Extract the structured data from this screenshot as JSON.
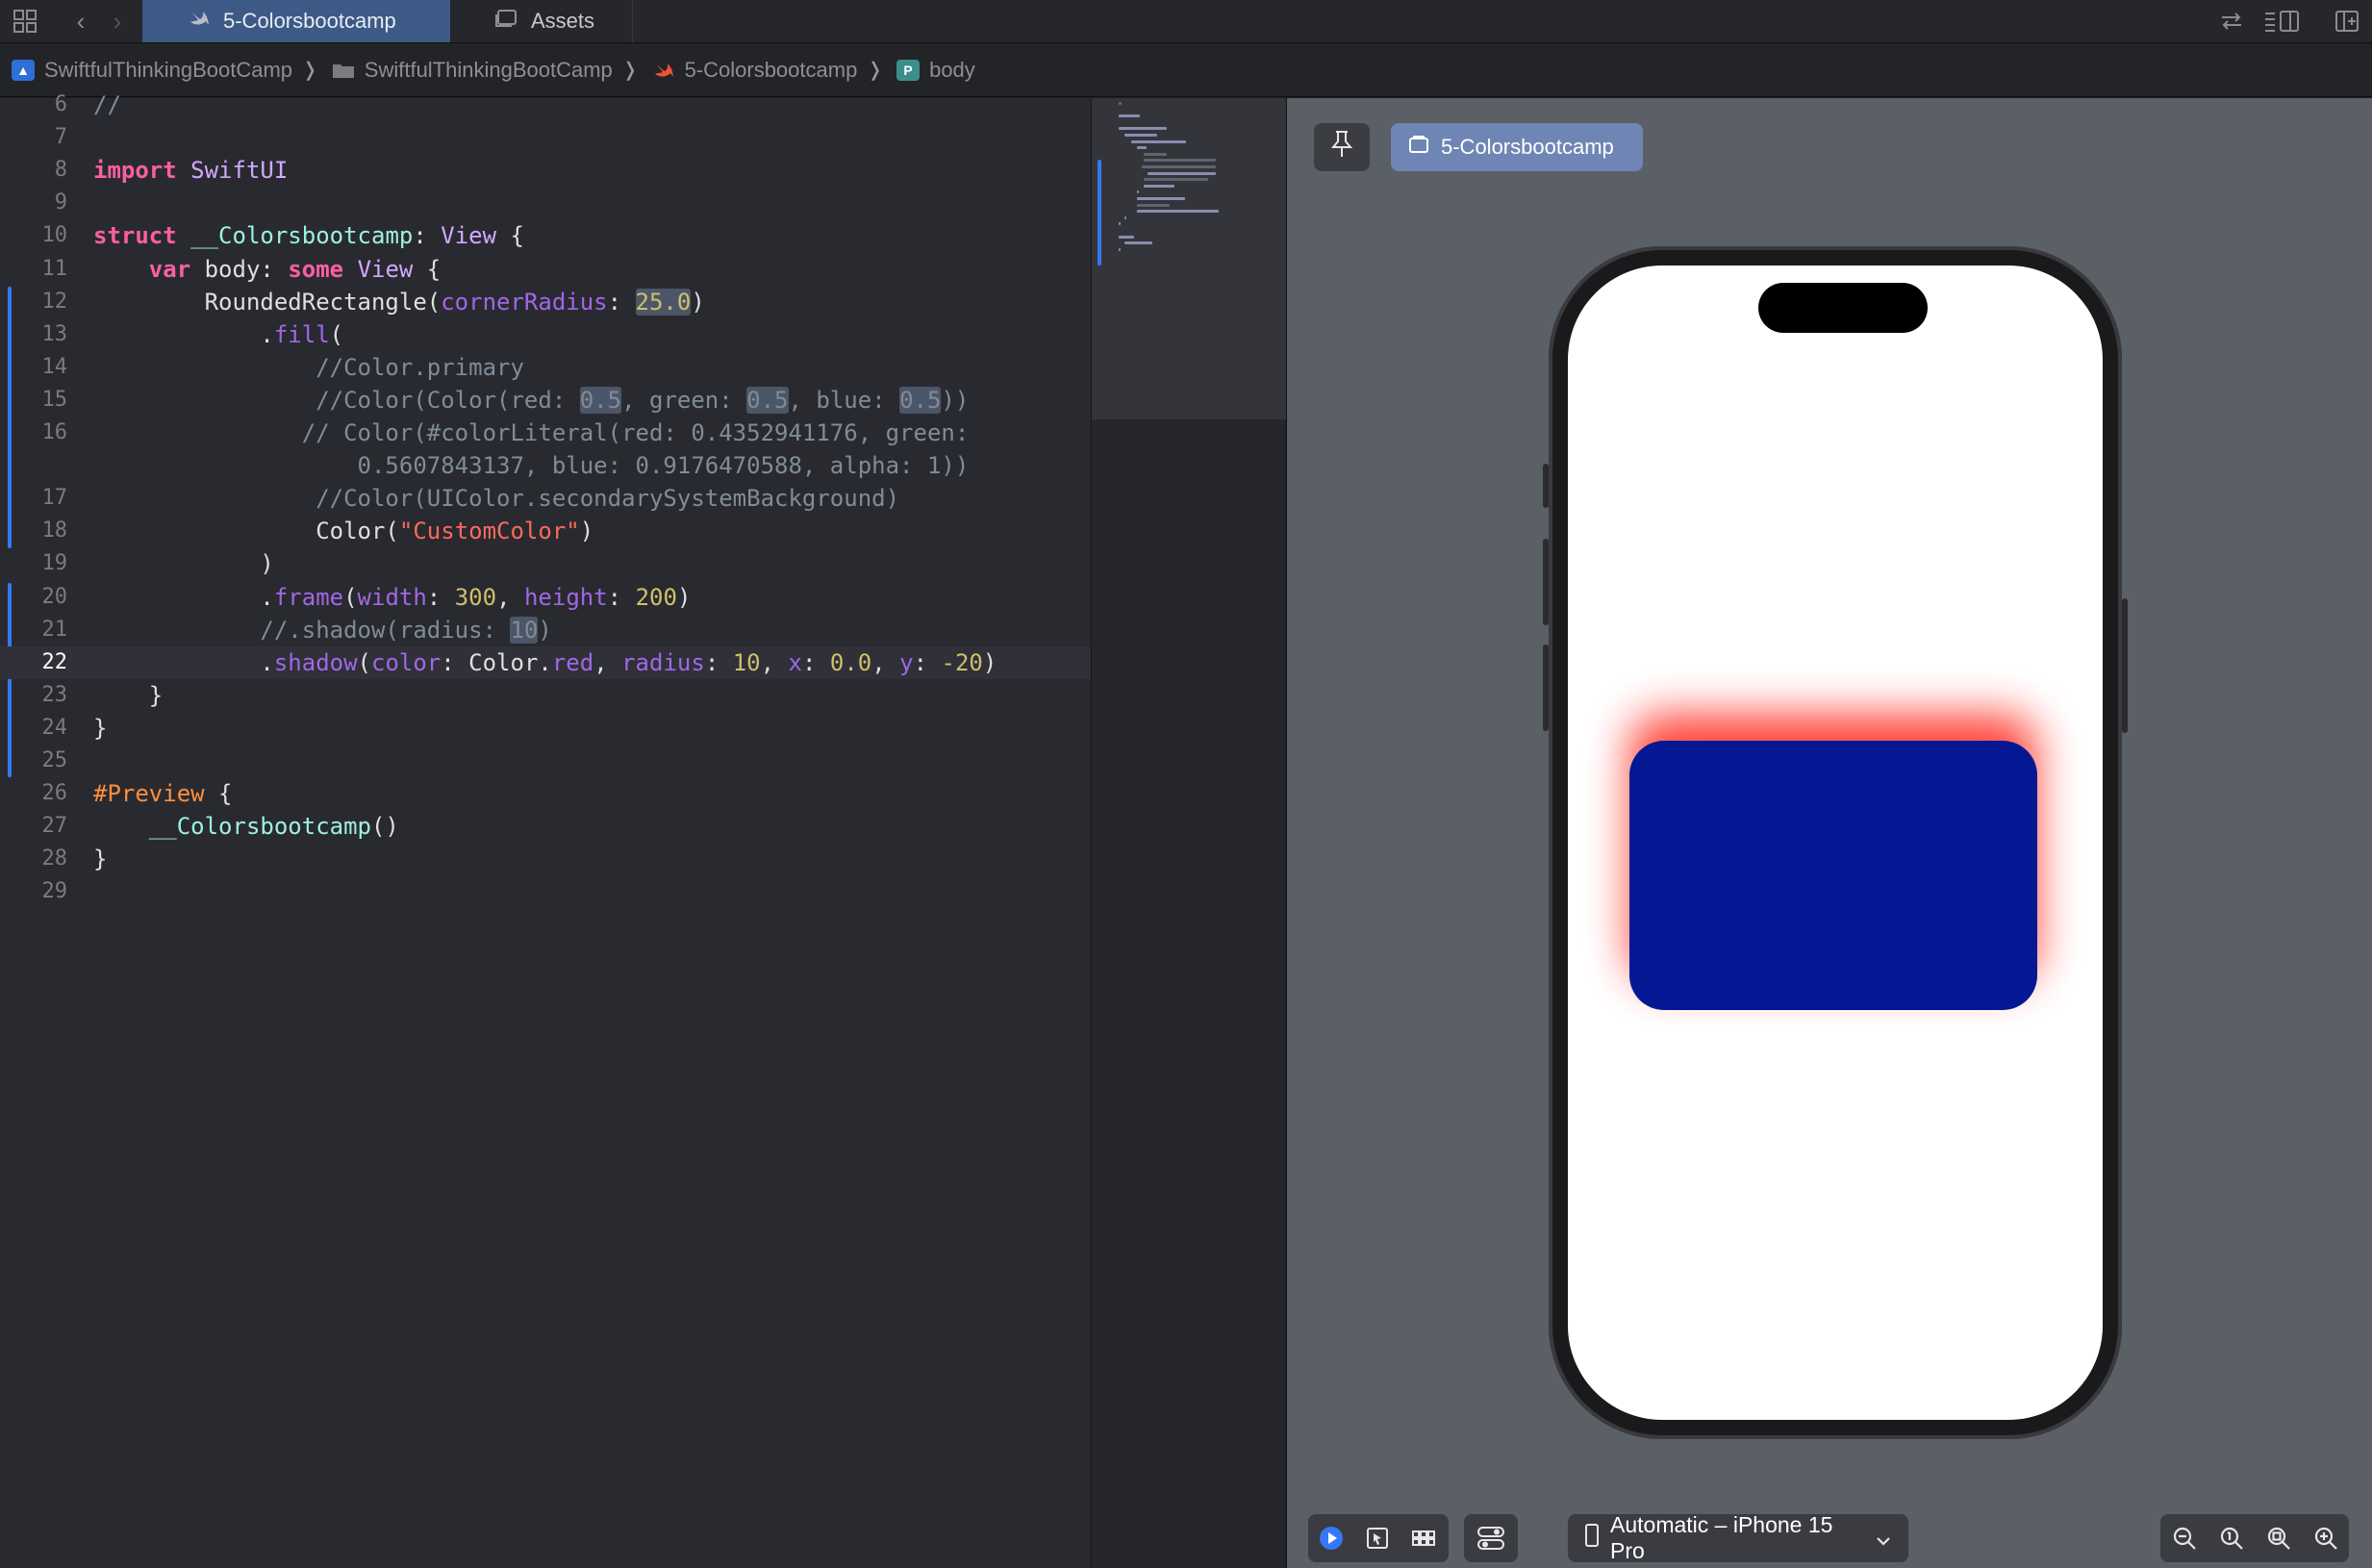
{
  "tabs": [
    {
      "label": "5-Colorsbootcamp",
      "active": true,
      "icon": "swift-icon"
    },
    {
      "label": "Assets",
      "active": false,
      "icon": "assets-icon"
    }
  ],
  "breadcrumb": [
    {
      "label": "SwiftfulThinkingBootCamp",
      "icon": "project-icon"
    },
    {
      "label": "SwiftfulThinkingBootCamp",
      "icon": "folder-icon"
    },
    {
      "label": "5-Colorsbootcamp",
      "icon": "swift-icon"
    },
    {
      "label": "body",
      "icon": "property-icon",
      "badge": "P"
    }
  ],
  "editor": {
    "current_line": "22",
    "lines": [
      {
        "n": "6",
        "text": "//"
      },
      {
        "n": "7",
        "text": ""
      },
      {
        "n": "8",
        "text": "import SwiftUI"
      },
      {
        "n": "9",
        "text": ""
      },
      {
        "n": "10",
        "text": "struct __Colorsbootcamp: View {"
      },
      {
        "n": "11",
        "text": "    var body: some View {"
      },
      {
        "n": "12",
        "text": "        RoundedRectangle(cornerRadius: 25.0)"
      },
      {
        "n": "13",
        "text": "            .fill("
      },
      {
        "n": "14",
        "text": "                //Color.primary"
      },
      {
        "n": "15",
        "text": "                //Color(Color(red: 0.5, green: 0.5, blue: 0.5))"
      },
      {
        "n": "16",
        "text": "               // Color(#colorLiteral(red: 0.4352941176, green:"
      },
      {
        "n": "",
        "text": "                   0.5607843137, blue: 0.9176470588, alpha: 1))"
      },
      {
        "n": "17",
        "text": "                //Color(UIColor.secondarySystemBackground)"
      },
      {
        "n": "18",
        "text": "                Color(\"CustomColor\")"
      },
      {
        "n": "19",
        "text": "            )"
      },
      {
        "n": "20",
        "text": "            .frame(width: 300, height: 200)"
      },
      {
        "n": "21",
        "text": "            //.shadow(radius: 10)"
      },
      {
        "n": "22",
        "text": "            .shadow(color: Color.red, radius: 10, x: 0.0, y: -20)"
      },
      {
        "n": "23",
        "text": "    }"
      },
      {
        "n": "24",
        "text": "}"
      },
      {
        "n": "25",
        "text": ""
      },
      {
        "n": "26",
        "text": "#Preview {"
      },
      {
        "n": "27",
        "text": "    __Colorsbootcamp()"
      },
      {
        "n": "28",
        "text": "}"
      },
      {
        "n": "29",
        "text": ""
      }
    ]
  },
  "preview": {
    "pin_icon": "pin-icon",
    "chip_label": "5-Colorsbootcamp",
    "fill_color": "#051893",
    "shadow_color": "#ff3b30",
    "device_label": "Automatic – iPhone 15 Pro"
  },
  "colors": {
    "accent": "#3478f6",
    "keyword": "#fc5fa3",
    "string": "#fc6a5d",
    "number": "#d0bf69",
    "comment": "#7f8c98"
  }
}
